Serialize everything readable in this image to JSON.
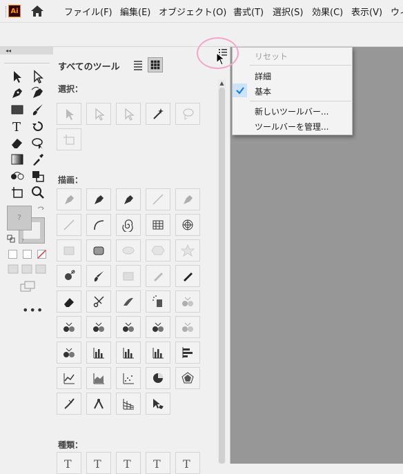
{
  "app": {
    "logo_text": "Ai"
  },
  "menubar": {
    "items": [
      "ファイル(F)",
      "編集(E)",
      "オブジェクト(O)",
      "書式(T)",
      "選択(S)",
      "効果(C)",
      "表示(V)",
      "ウィ"
    ]
  },
  "panel": {
    "title": "すべてのツール",
    "sections": [
      {
        "title": "選択：",
        "tools": [
          "selection-tool",
          "direct-selection-tool",
          "group-selection-tool",
          "magic-wand-tool",
          "lasso-tool",
          "artboard-tool"
        ]
      },
      {
        "title": "描画：",
        "tools": [
          "pen-tool",
          "add-anchor-point-tool",
          "delete-anchor-point-tool",
          "anchor-point-tool",
          "curvature-tool",
          "line-segment-tool",
          "arc-tool",
          "spiral-tool",
          "rectangular-grid-tool",
          "polar-grid-tool",
          "rectangle-tool",
          "rounded-rectangle-tool",
          "ellipse-tool",
          "polygon-tool",
          "star-tool",
          "flare-tool",
          "paintbrush-tool",
          "shaper-tool",
          "pencil-tool",
          "blob-brush-tool",
          "eraser-tool",
          "scissors-tool",
          "knife-tool",
          "symbol-sprayer-tool",
          "symbol-shifter-tool",
          "symbol-scruncher-tool",
          "symbol-sizer-tool",
          "symbol-spinner-tool",
          "symbol-stainer-tool",
          "symbol-screener-tool",
          "symbol-styler-tool",
          "column-graph-tool",
          "stacked-column-graph-tool",
          "bar-graph-tool",
          "stacked-bar-graph-tool",
          "line-graph-tool",
          "area-graph-tool",
          "scatter-graph-tool",
          "pie-graph-tool",
          "radar-graph-tool",
          "width-tool",
          "puppet-warp-tool",
          "perspective-grid-tool",
          "shape-builder-tool"
        ]
      },
      {
        "title": "種類：",
        "tools": [
          "type-tool",
          "area-type-tool",
          "type-on-path-tool",
          "vertical-type-tool",
          "vertical-area-type-tool"
        ]
      }
    ]
  },
  "dropdown": {
    "items": [
      {
        "label": "リセット",
        "disabled": true
      },
      {
        "label": "詳細",
        "checked": false
      },
      {
        "label": "基本",
        "checked": true
      },
      {
        "label": "新しいツールバー..."
      },
      {
        "label": "ツールバーを管理..."
      }
    ]
  },
  "fill_stroke": {
    "fill_label": "?",
    "stroke_label": "?"
  },
  "more_tools_label": "•••",
  "colors": {
    "canvas": "#979797",
    "check": "#1473e6",
    "highlight": "#f4a6c8",
    "logo_bg": "#330000",
    "logo_fg": "#ff9a00"
  }
}
